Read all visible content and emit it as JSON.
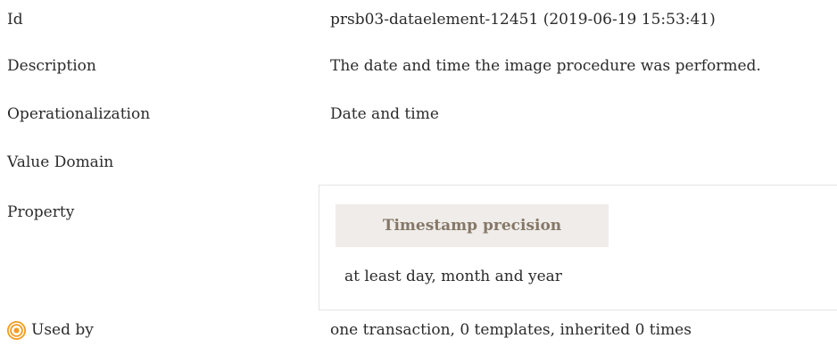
{
  "rows": {
    "id": {
      "label": "Id",
      "value": "prsb03-dataelement-12451 (2019-06-19 15:53:41)"
    },
    "description": {
      "label": "Description",
      "value": "The date and time the image procedure was performed."
    },
    "operationalization": {
      "label": "Operationalization",
      "value": "Date and time"
    },
    "value_domain": {
      "label": "Value Domain"
    },
    "property": {
      "label": "Property",
      "header": "Timestamp precision",
      "value": "at least day, month and year"
    },
    "used_by": {
      "icon": "target-icon",
      "label": "Used by",
      "value": "one transaction, 0 templates, inherited 0 times"
    }
  },
  "colors": {
    "accent": "#f29b1d",
    "header_bg": "#efece9",
    "header_text": "#857868",
    "border": "#e4e4e4"
  }
}
